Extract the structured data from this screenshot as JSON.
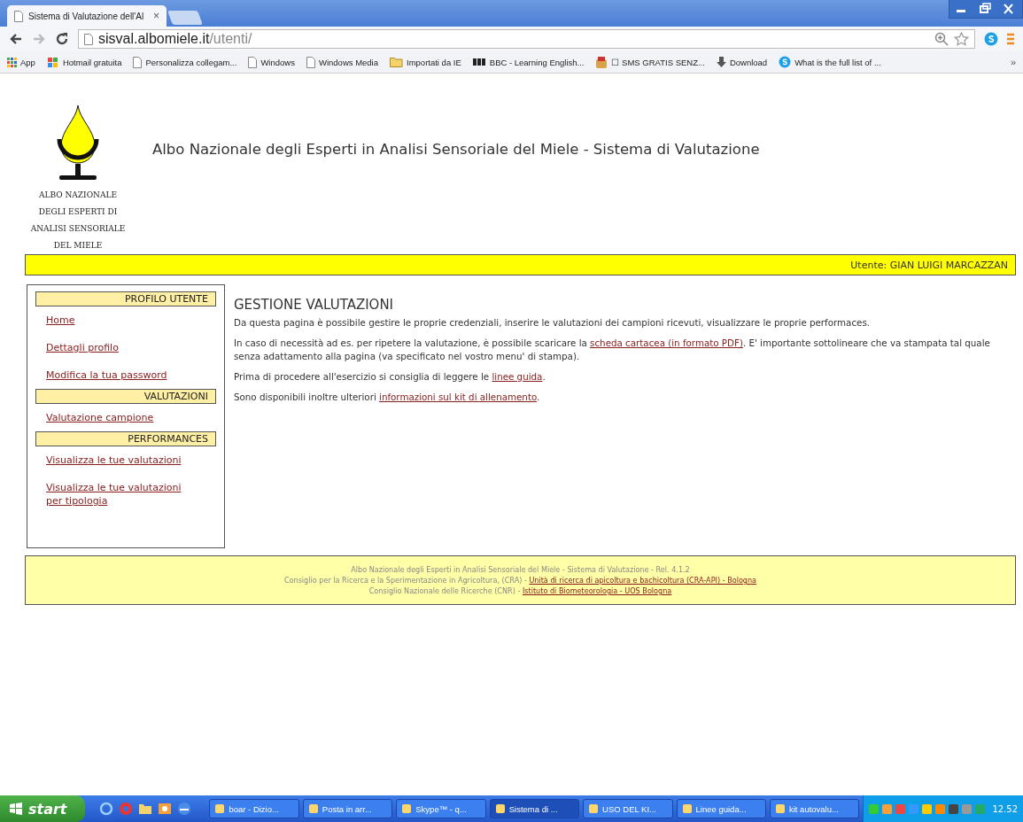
{
  "browser": {
    "tabs": [
      {
        "title": "Sistema di Valutazione dell'Al",
        "close": "×",
        "selected": true
      }
    ],
    "address": {
      "host": "sisval.albomiele.it",
      "path": "/utenti/"
    },
    "bookmarks": [
      {
        "label": "App",
        "kind": "apps"
      },
      {
        "label": "Hotmail gratuita",
        "kind": "windows"
      },
      {
        "label": "Personalizza collegam...",
        "kind": "page"
      },
      {
        "label": "Windows",
        "kind": "page"
      },
      {
        "label": "Windows Media",
        "kind": "page"
      },
      {
        "label": "Importati da IE",
        "kind": "folder"
      },
      {
        "label": "BBC - Learning English...",
        "kind": "bbc"
      },
      {
        "label": "☐ SMS GRATIS SENZ...",
        "kind": "bag"
      },
      {
        "label": "Download",
        "kind": "download"
      },
      {
        "label": "What is the full list of ...",
        "kind": "skype"
      }
    ],
    "overflow": "»"
  },
  "site": {
    "logo_lines": [
      "ALBO NAZIONALE",
      "DEGLI ESPERTI DI",
      "ANALISI SENSORIALE",
      "DEL MIELE"
    ],
    "title": "Albo Nazionale degli Esperti in Analisi Sensoriale del Miele - Sistema di Valutazione",
    "user": "Utente: GIAN LUIGI MARCAZZAN"
  },
  "sidebar": [
    {
      "heading": "PROFILO UTENTE",
      "links": [
        [
          "Home"
        ],
        [
          "Dettagli profilo"
        ],
        [
          "Modifica la tua password"
        ]
      ]
    },
    {
      "heading": "VALUTAZIONI",
      "links": [
        [
          "Valutazione campione"
        ]
      ]
    },
    {
      "heading": "PERFORMANCES",
      "links": [
        [
          "Visualizza le tue valutazioni"
        ],
        [
          "Visualizza le tue valutazioni",
          "per tipologia"
        ]
      ]
    }
  ],
  "content": {
    "heading": "GESTIONE VALUTAZIONI",
    "paragraphs": [
      {
        "before": "Da questa pagina è possibile gestire le proprie credenziali, inserire le valutazioni dei campioni ricevuti, visualizzare le proprie performaces."
      },
      {
        "before": "In caso di necessità ad es. per ripetere la valutazione, è possibile scaricare la ",
        "link": "scheda cartacea (in formato PDF)",
        "after": ". E' importante sottolineare che va stampata tal quale senza adattamento alla pagina (va specificato nel vostro menu' di stampa)."
      },
      {
        "before": "Prima di procedere all'esercizio si consiglia di leggere le ",
        "link": "linee guida",
        "after": "."
      },
      {
        "before": "Sono disponibili inoltre ulteriori ",
        "link": "informazioni sul kit di allenamento",
        "after": "."
      }
    ]
  },
  "footer": [
    {
      "before": "Albo Nazionale degli Esperti in Analisi Sensoriale del Miele - Sistema di Valutazione - Rel. 4.1.2"
    },
    {
      "before": "Consiglio per la Ricerca e la Sperimentazione in Agricoltura, (CRA) - ",
      "link": "Unità di ricerca di apicoltura e bachicoltura (CRA-API) - Bologna"
    },
    {
      "before": "Consiglio Nazionale delle Ricerche (CNR) - ",
      "link": "Istituto di Biometeorologia - UOS Bologna"
    }
  ],
  "taskbar": {
    "start": "start",
    "windows": [
      {
        "label": "boar - Dizio...",
        "selected": false
      },
      {
        "label": "Posta in arr...",
        "selected": false
      },
      {
        "label": "Skype™ - q...",
        "selected": false
      },
      {
        "label": "Sistema di ...",
        "selected": true
      },
      {
        "label": "USO DEL KI...",
        "selected": false
      },
      {
        "label": "Linee guida...",
        "selected": false
      },
      {
        "label": "kit autovalu...",
        "selected": false
      }
    ],
    "clock": "12.52"
  }
}
